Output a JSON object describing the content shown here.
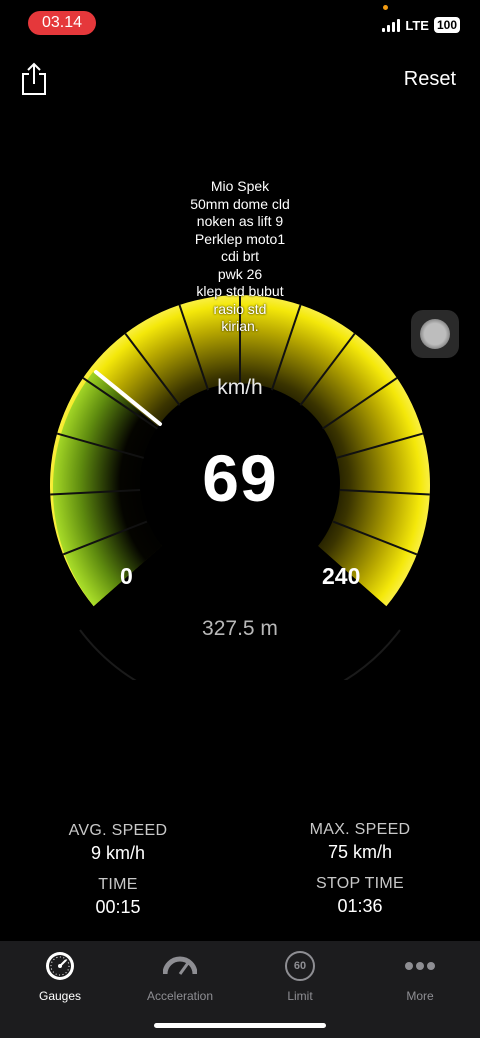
{
  "status_bar": {
    "time": "03.14",
    "network": "LTE",
    "battery": "100"
  },
  "header": {
    "share_icon": "share-icon",
    "reset_label": "Reset"
  },
  "note_lines": [
    "Mio Spek",
    "50mm dome cld",
    "noken as lift 9",
    "Perklep moto1",
    "cdi brt",
    "pwk 26",
    "klep std bubut",
    "rasio std",
    "kirian."
  ],
  "gauge": {
    "unit": "km/h",
    "speed": "69",
    "min": "0",
    "max": "240",
    "distance": "327.5 m",
    "colors": {
      "arc": "#f5e50a",
      "low": "#a8e02a"
    }
  },
  "stats": {
    "avg_speed_label": "AVG. SPEED",
    "avg_speed_value": "9 km/h",
    "max_speed_label": "MAX. SPEED",
    "max_speed_value": "75 km/h",
    "time_label": "TIME",
    "time_value": "00:15",
    "stop_time_label": "STOP TIME",
    "stop_time_value": "01:36"
  },
  "tabs": [
    {
      "label": "Gauges",
      "icon": "gauge-icon",
      "active": true
    },
    {
      "label": "Acceleration",
      "icon": "acceleration-icon",
      "active": false
    },
    {
      "label": "Limit",
      "icon": "speed-limit-icon",
      "limit_value": "60",
      "active": false
    },
    {
      "label": "More",
      "icon": "more-icon",
      "active": false
    }
  ]
}
